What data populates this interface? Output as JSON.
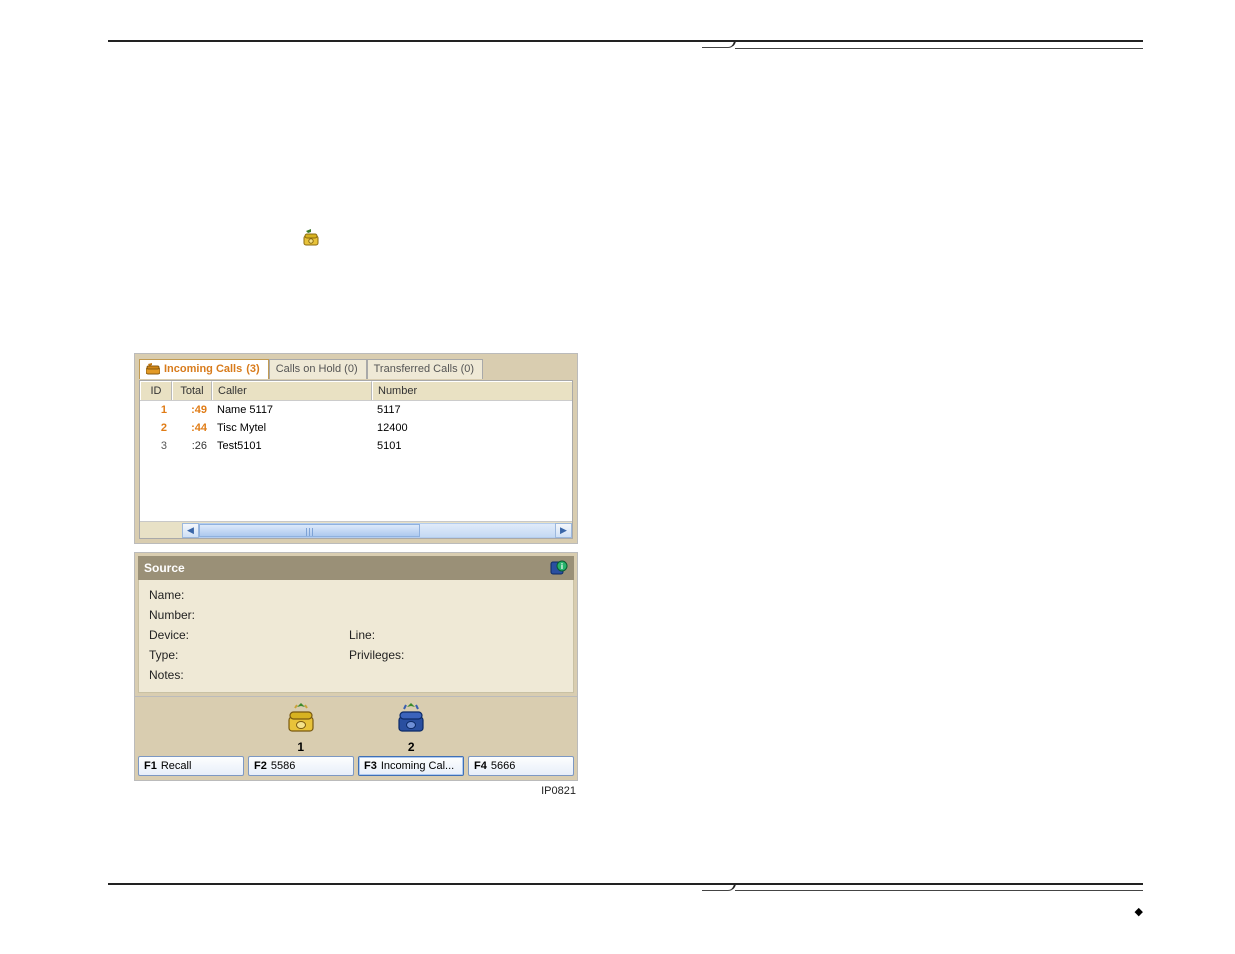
{
  "inline_icon_title": "incoming-call icon",
  "tabs": {
    "incoming": {
      "label": "Incoming Calls",
      "count": "(3)"
    },
    "hold": {
      "label": "Calls on Hold (0)"
    },
    "xfer": {
      "label": "Transferred Calls (0)"
    }
  },
  "grid": {
    "headers": {
      "id": "ID",
      "total": "Total",
      "caller": "Caller",
      "number": "Number"
    },
    "rows": [
      {
        "id": "1",
        "total": ":49",
        "caller": "Name 5117",
        "number": "5117"
      },
      {
        "id": "2",
        "total": ":44",
        "caller": "Tisc Mytel",
        "number": "12400"
      },
      {
        "id": "3",
        "total": ":26",
        "caller": "Test5101",
        "number": "5101"
      }
    ]
  },
  "source": {
    "title": "Source",
    "fields": {
      "name": "Name:",
      "number": "Number:",
      "device": "Device:",
      "line": "Line:",
      "type": "Type:",
      "privileges": "Privileges:",
      "notes": "Notes:"
    }
  },
  "softkeys": {
    "phone_numbers": {
      "p1": "1",
      "p2": "2"
    },
    "f1": {
      "fn": "F1",
      "label": "Recall"
    },
    "f2": {
      "fn": "F2",
      "label": "5586"
    },
    "f3": {
      "fn": "F3",
      "label": "Incoming Cal..."
    },
    "f4": {
      "fn": "F4",
      "label": "5666"
    }
  },
  "image_id": "IP0821"
}
